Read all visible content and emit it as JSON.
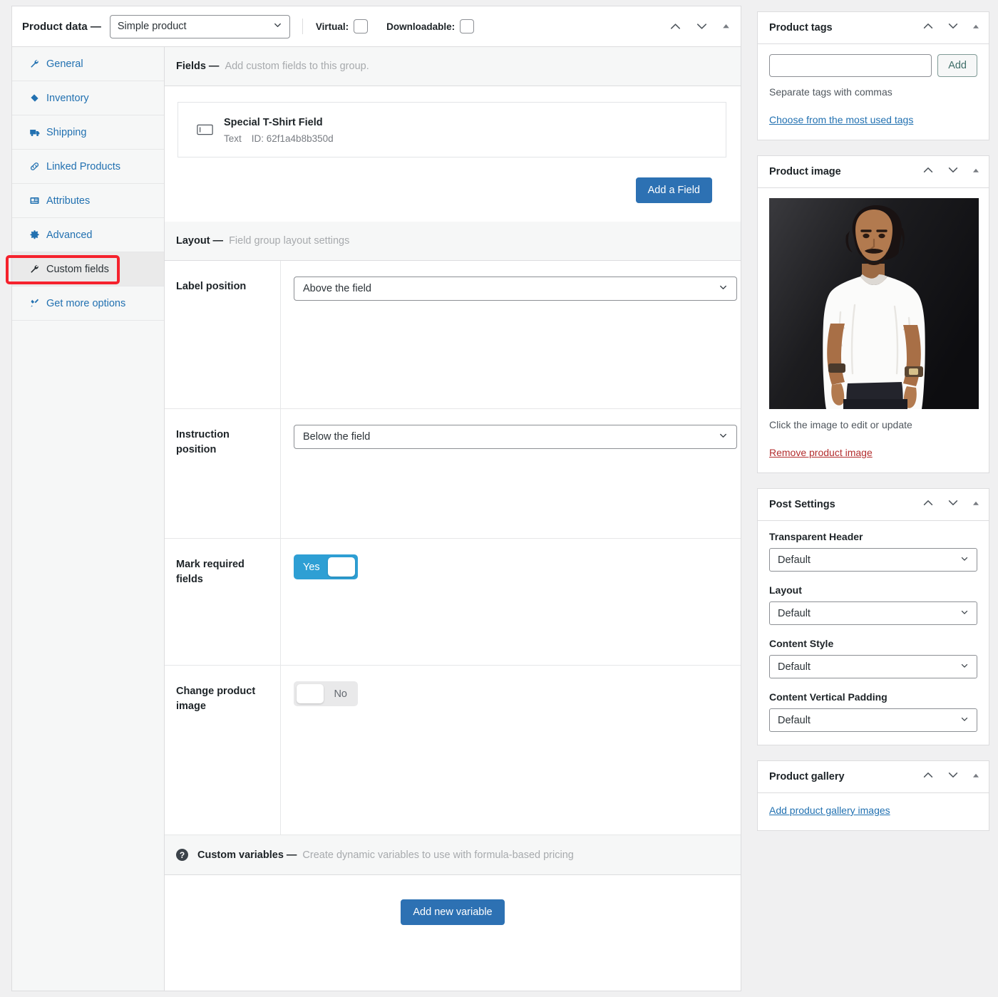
{
  "product_data": {
    "title": "Product data —",
    "type_selected": "Simple product",
    "virtual_label": "Virtual:",
    "virtual_checked": false,
    "downloadable_label": "Downloadable:",
    "downloadable_checked": false,
    "tabs": [
      {
        "label": "General",
        "icon": "wrench-icon",
        "active": false
      },
      {
        "label": "Inventory",
        "icon": "tag-icon",
        "active": false
      },
      {
        "label": "Shipping",
        "icon": "truck-icon",
        "active": false
      },
      {
        "label": "Linked Products",
        "icon": "link-icon",
        "active": false
      },
      {
        "label": "Attributes",
        "icon": "list-icon",
        "active": false
      },
      {
        "label": "Advanced",
        "icon": "gear-icon",
        "active": false
      },
      {
        "label": "Custom fields",
        "icon": "wrench-icon",
        "active": true
      },
      {
        "label": "Get more options",
        "icon": "plugin-icon",
        "active": false
      }
    ],
    "fields_section": {
      "heading": "Fields —",
      "description": "Add custom fields to this group.",
      "items": [
        {
          "name": "Special T-Shirt Field",
          "type": "Text",
          "id": "ID: 62f1a4b8b350d",
          "icon": "text-field-icon"
        }
      ],
      "add_field_label": "Add a Field"
    },
    "layout_section": {
      "heading": "Layout —",
      "description": "Field group layout settings",
      "rows": [
        {
          "label": "Label position",
          "control": "select",
          "value": "Above the field"
        },
        {
          "label": "Instruction position",
          "control": "select",
          "value": "Below the field"
        },
        {
          "label": "Mark required fields",
          "control": "toggle",
          "value": "Yes",
          "on": true
        },
        {
          "label": "Change product image",
          "control": "toggle",
          "value": "No",
          "on": false
        }
      ]
    },
    "variables_section": {
      "help_icon": "question-mark-icon",
      "heading": "Custom variables —",
      "description": "Create dynamic variables to use with formula-based pricing",
      "add_variable_label": "Add new variable"
    }
  },
  "sidebar": {
    "product_tags": {
      "title": "Product tags",
      "input_value": "",
      "input_placeholder": "",
      "add_label": "Add",
      "hint": "Separate tags with commas",
      "most_used_link": "Choose from the most used tags"
    },
    "product_image": {
      "title": "Product image",
      "caption": "Click the image to edit or update",
      "remove_link": "Remove product image",
      "alt": "Man wearing a white t-shirt on a dark background"
    },
    "post_settings": {
      "title": "Post Settings",
      "fields": [
        {
          "label": "Transparent Header",
          "value": "Default"
        },
        {
          "label": "Layout",
          "value": "Default"
        },
        {
          "label": "Content Style",
          "value": "Default"
        },
        {
          "label": "Content Vertical Padding",
          "value": "Default"
        }
      ]
    },
    "product_gallery": {
      "title": "Product gallery",
      "add_link": "Add product gallery images"
    }
  },
  "colors": {
    "accent_blue": "#2271b1",
    "primary_button": "#2d71b3",
    "toggle_on": "#2e9fd4",
    "highlight_red": "#f5222d",
    "danger_link": "#b32d2e"
  }
}
